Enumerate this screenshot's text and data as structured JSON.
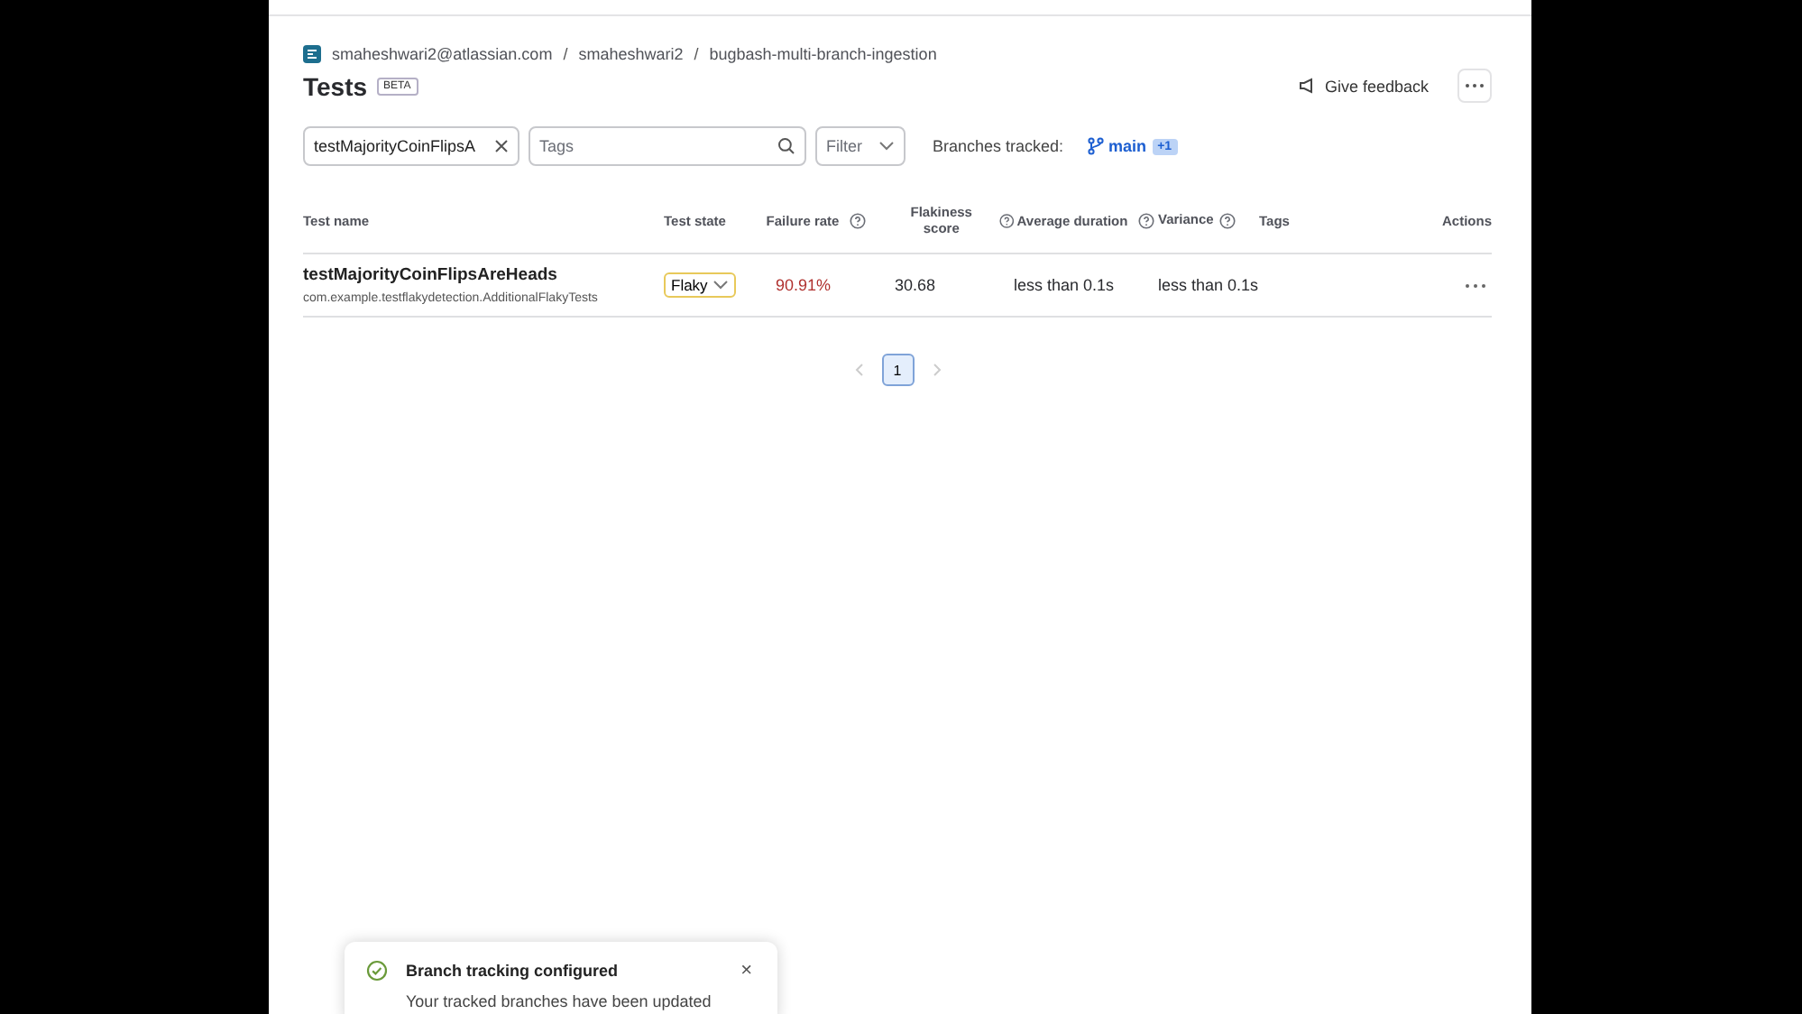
{
  "breadcrumb": [
    "smaheshwari2@atlassian.com",
    "smaheshwari2",
    "bugbash-multi-branch-ingestion"
  ],
  "breadcrumb_separator": "/",
  "title": "Tests",
  "title_badge": "BETA",
  "feedback_button": "Give feedback",
  "search": {
    "value": "testMajorityCoinFlipsA"
  },
  "tags_field": {
    "placeholder": "Tags"
  },
  "filter": {
    "placeholder": "Filter"
  },
  "branches": {
    "label": "Branches tracked:",
    "branch": "main",
    "extra": "+1"
  },
  "table": {
    "columns": [
      {
        "label": "Test name",
        "help": false
      },
      {
        "label": "Test state",
        "help": false
      },
      {
        "label": "Failure rate",
        "help": true
      },
      {
        "label": "Flakiness score",
        "help": true
      },
      {
        "label": "Average duration",
        "help": true
      },
      {
        "label": "Variance",
        "help": true
      },
      {
        "label": "Tags",
        "help": false
      },
      {
        "label": "Actions",
        "help": false
      }
    ],
    "rows": [
      {
        "name": "testMajorityCoinFlipsAreHeads",
        "class": "com.example.testflakydetection.AdditionalFlakyTests",
        "state": "Flaky",
        "failure_rate": "90.91%",
        "flakiness_score": "30.68",
        "average_duration": "less than 0.1s",
        "variance": "less than 0.1s"
      }
    ]
  },
  "pagination": {
    "pages": [
      {
        "label": "1",
        "selected": true
      }
    ],
    "prev_disabled": true,
    "next_disabled": true
  },
  "toast": {
    "close": "×",
    "title": "Branch tracking configured",
    "message": "Your tracked branches have been updated"
  }
}
